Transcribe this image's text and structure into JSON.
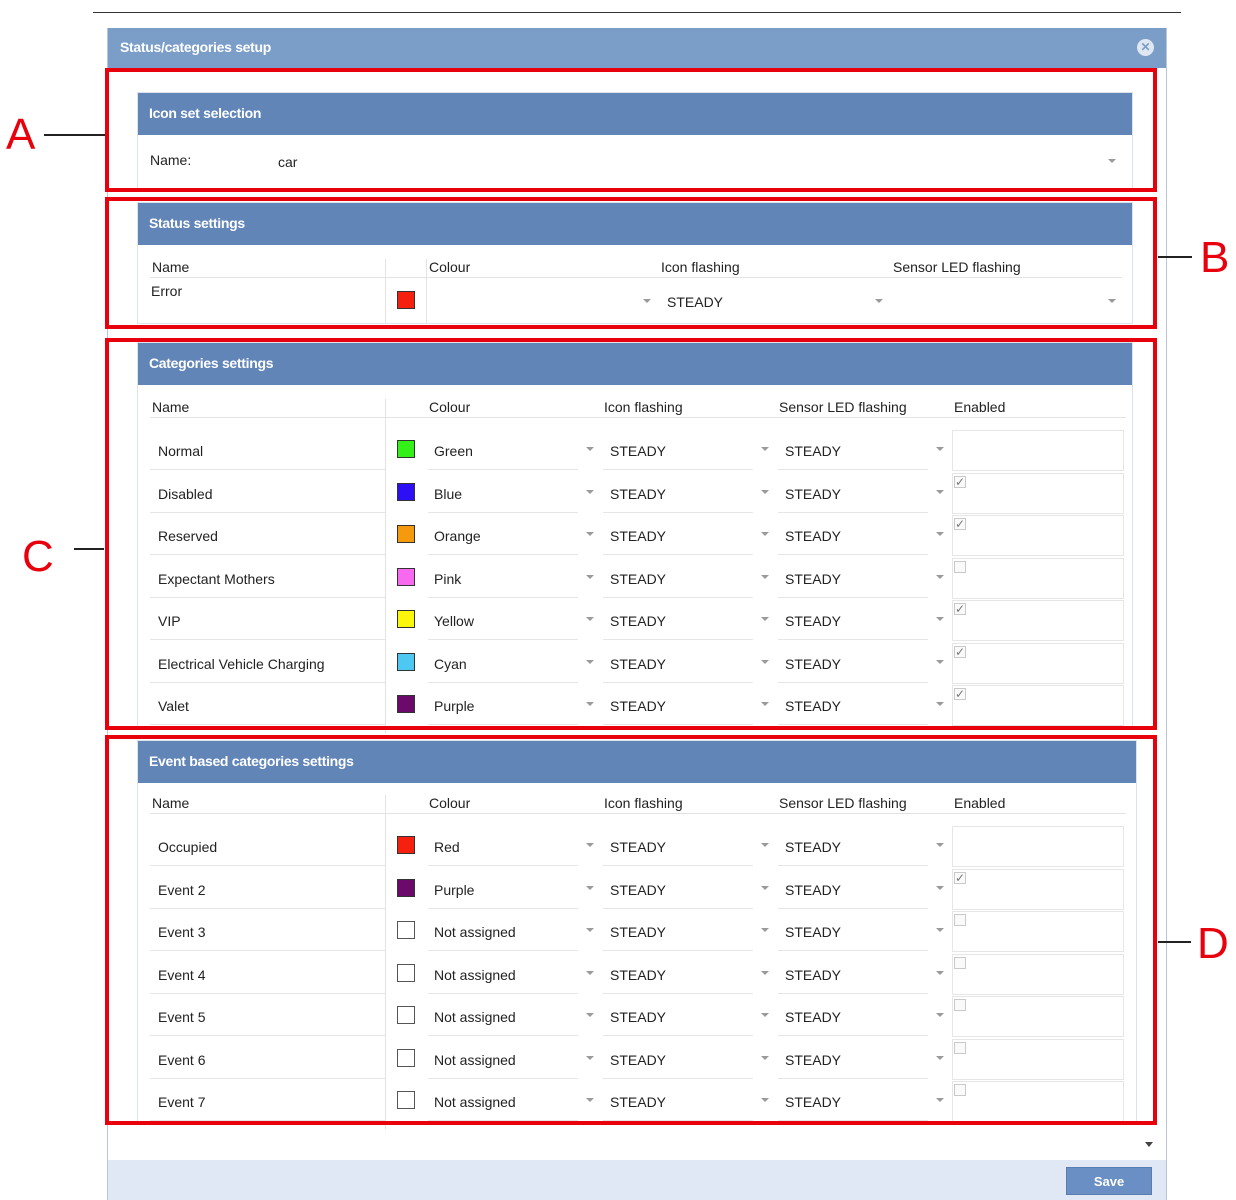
{
  "dialog": {
    "title": "Status/categories setup",
    "close_icon": "close-icon"
  },
  "icon_set": {
    "title": "Icon set selection",
    "name_label": "Name:",
    "name_value": "car"
  },
  "status": {
    "title": "Status settings",
    "headers": {
      "name": "Name",
      "colour": "Colour",
      "icon_flashing": "Icon flashing",
      "sensor_led": "Sensor LED flashing"
    },
    "rows": [
      {
        "name": "Error",
        "color": "#f5200e",
        "icon_flashing": "STEADY"
      }
    ]
  },
  "categories": {
    "title": "Categories settings",
    "headers": {
      "name": "Name",
      "colour": "Colour",
      "icon_flashing": "Icon flashing",
      "sensor_led": "Sensor LED flashing",
      "enabled": "Enabled"
    },
    "rows": [
      {
        "name": "Normal",
        "color_name": "Green",
        "color": "#33f018",
        "icon_flashing": "STEADY",
        "sensor_led": "STEADY",
        "enabled": null
      },
      {
        "name": "Disabled",
        "color_name": "Blue",
        "color": "#2c0ff5",
        "icon_flashing": "STEADY",
        "sensor_led": "STEADY",
        "enabled": true
      },
      {
        "name": "Reserved",
        "color_name": "Orange",
        "color": "#f59a0c",
        "icon_flashing": "STEADY",
        "sensor_led": "STEADY",
        "enabled": true
      },
      {
        "name": "Expectant Mothers",
        "color_name": "Pink",
        "color": "#f76af0",
        "icon_flashing": "STEADY",
        "sensor_led": "STEADY",
        "enabled": false
      },
      {
        "name": "VIP",
        "color_name": "Yellow",
        "color": "#fbf60a",
        "icon_flashing": "STEADY",
        "sensor_led": "STEADY",
        "enabled": true
      },
      {
        "name": "Electrical Vehicle Charging",
        "color_name": "Cyan",
        "color": "#4cc8f3",
        "icon_flashing": "STEADY",
        "sensor_led": "STEADY",
        "enabled": true
      },
      {
        "name": "Valet",
        "color_name": "Purple",
        "color": "#6b0a6b",
        "icon_flashing": "STEADY",
        "sensor_led": "STEADY",
        "enabled": true
      }
    ]
  },
  "events": {
    "title": "Event based categories settings",
    "headers": {
      "name": "Name",
      "colour": "Colour",
      "icon_flashing": "Icon flashing",
      "sensor_led": "Sensor LED flashing",
      "enabled": "Enabled"
    },
    "rows": [
      {
        "name": "Occupied",
        "color_name": "Red",
        "color": "#f5200e",
        "icon_flashing": "STEADY",
        "sensor_led": "STEADY",
        "enabled": null
      },
      {
        "name": "Event 2",
        "color_name": "Purple",
        "color": "#6b0a6b",
        "icon_flashing": "STEADY",
        "sensor_led": "STEADY",
        "enabled": true
      },
      {
        "name": "Event 3",
        "color_name": "Not assigned",
        "color": "#ffffff",
        "icon_flashing": "STEADY",
        "sensor_led": "STEADY",
        "enabled": false
      },
      {
        "name": "Event 4",
        "color_name": "Not assigned",
        "color": "#ffffff",
        "icon_flashing": "STEADY",
        "sensor_led": "STEADY",
        "enabled": false
      },
      {
        "name": "Event 5",
        "color_name": "Not assigned",
        "color": "#ffffff",
        "icon_flashing": "STEADY",
        "sensor_led": "STEADY",
        "enabled": false
      },
      {
        "name": "Event 6",
        "color_name": "Not assigned",
        "color": "#ffffff",
        "icon_flashing": "STEADY",
        "sensor_led": "STEADY",
        "enabled": false
      },
      {
        "name": "Event 7",
        "color_name": "Not assigned",
        "color": "#ffffff",
        "icon_flashing": "STEADY",
        "sensor_led": "STEADY",
        "enabled": false
      }
    ]
  },
  "callouts": {
    "a": "A",
    "b": "B",
    "c": "C",
    "d": "D"
  },
  "footer": {
    "save_label": "Save"
  },
  "colors": {
    "header_bar": "#7b9ec9",
    "panel_header": "#6285b8",
    "callout": "#e8000d"
  }
}
